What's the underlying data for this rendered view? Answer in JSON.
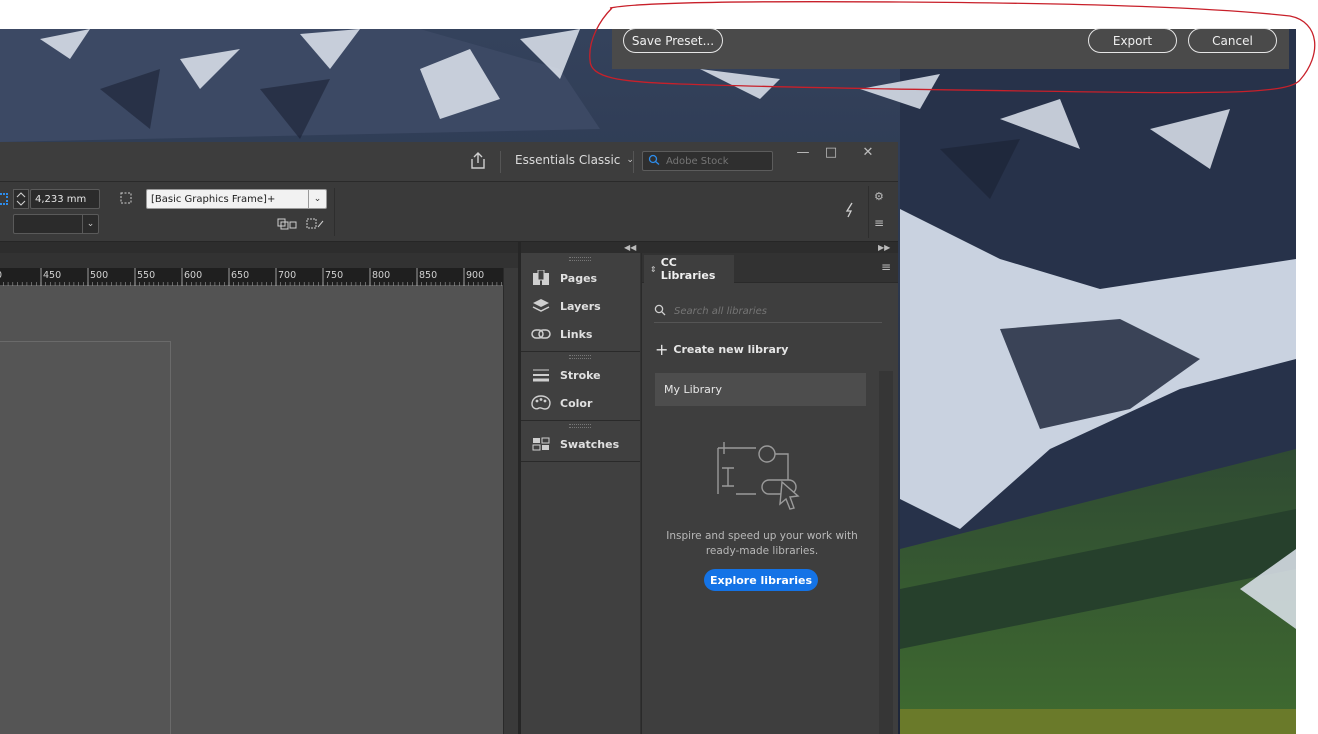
{
  "dialog": {
    "save_preset_label": "Save Preset...",
    "export_label": "Export",
    "cancel_label": "Cancel"
  },
  "titlebar": {
    "workspace_label": "Essentials Classic",
    "stock_search_placeholder": "Adobe Stock"
  },
  "control_panel": {
    "stroke_weight_value": "4,233 mm",
    "object_style_value": "[Basic Graphics Frame]+"
  },
  "ruler": {
    "ticks": [
      "0",
      "450",
      "500",
      "550",
      "600",
      "650",
      "700",
      "750",
      "800",
      "850",
      "900"
    ]
  },
  "dock": {
    "items": [
      {
        "label": "Pages",
        "icon": "pages-icon"
      },
      {
        "label": "Layers",
        "icon": "layers-icon"
      },
      {
        "label": "Links",
        "icon": "links-icon"
      },
      {
        "label": "Stroke",
        "icon": "stroke-icon"
      },
      {
        "label": "Color",
        "icon": "color-palette-icon"
      },
      {
        "label": "Swatches",
        "icon": "swatches-icon"
      }
    ]
  },
  "cc_libraries": {
    "tab_label": "CC Libraries",
    "search_placeholder": "Search all libraries",
    "create_label": "Create new library",
    "library_name": "My Library",
    "empty_text": "Inspire and speed up your work with ready-made libraries.",
    "explore_label": "Explore libraries"
  },
  "colors": {
    "accent": "#1473e6",
    "annotation": "#c8202a",
    "panel_bg": "#3e3e3e"
  }
}
